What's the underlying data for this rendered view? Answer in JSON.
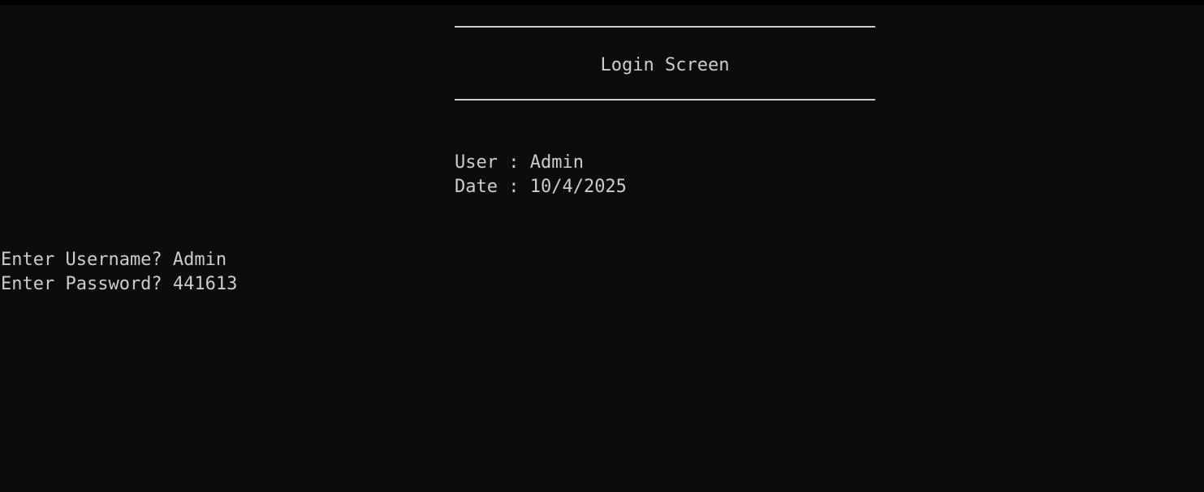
{
  "header": {
    "title": "Login Screen"
  },
  "info": {
    "user_label": "User : ",
    "user_value": "Admin",
    "date_label": "Date : ",
    "date_value": "10/4/2025"
  },
  "prompts": {
    "username_label": "Enter Username? ",
    "username_value": "Admin",
    "password_label": "Enter Password? ",
    "password_value": "441613"
  },
  "colors": {
    "background": "#0c0c0c",
    "text": "#cccccc"
  }
}
